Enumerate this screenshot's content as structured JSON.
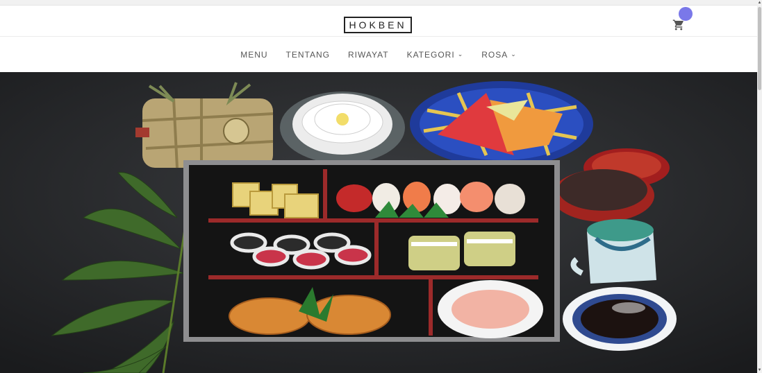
{
  "brand": {
    "logo_text": "HOKBEN"
  },
  "header": {
    "cart_icon": "cart-icon",
    "cart_count": ""
  },
  "nav": {
    "items": [
      {
        "label": "MENU",
        "has_dropdown": false
      },
      {
        "label": "TENTANG",
        "has_dropdown": false
      },
      {
        "label": "RIWAYAT",
        "has_dropdown": false
      },
      {
        "label": "KATEGORI",
        "has_dropdown": true
      },
      {
        "label": "ROSA",
        "has_dropdown": true
      }
    ]
  },
  "hero": {
    "image_icon": "bento-hero-image"
  },
  "colors": {
    "accent": "#7a78e9",
    "text": "#555555",
    "logo": "#222222"
  }
}
